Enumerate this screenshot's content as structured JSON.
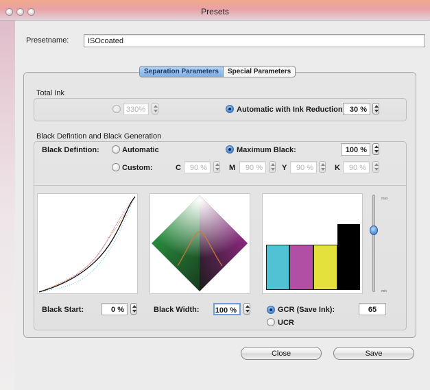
{
  "window": {
    "title": "Presets"
  },
  "preset": {
    "label": "Presetname:",
    "value": "ISOcoated"
  },
  "tabs": [
    {
      "label": "Separation Parameters",
      "active": true
    },
    {
      "label": "Special Parameters",
      "active": false
    }
  ],
  "total_ink": {
    "title": "Total Ink",
    "manual_value": "330%",
    "auto_label": "Automatic with Ink Reduction:",
    "auto_value": "30 %"
  },
  "black": {
    "section_title": "Black Defintion and Black Generation",
    "def_label": "Black Defintion:",
    "automatic_label": "Automatic",
    "maximum_label": "Maximum Black:",
    "maximum_value": "100 %",
    "custom_label": "Custom:",
    "c_label": "C",
    "c_value": "90 %",
    "m_label": "M",
    "m_value": "90 %",
    "y_label": "Y",
    "y_value": "90 %",
    "k_label": "K",
    "k_value": "90 %"
  },
  "generation": {
    "start_label": "Black Start:",
    "start_value": "0 %",
    "width_label": "Black Width:",
    "width_value": "100 %",
    "gcr_label": "GCR (Save Ink):",
    "gcr_value": "65",
    "ucr_label": "UCR",
    "slider_max": "max",
    "slider_min": "min",
    "slider_level": 0.65
  },
  "buttons": {
    "close": "Close",
    "save": "Save"
  },
  "colors": {
    "cyan": "#4fc3d4",
    "magenta": "#b04fa3",
    "yellow": "#e4e03c",
    "black": "#000000"
  },
  "icons": {
    "radio": "radio-button-icon",
    "stepper": "stepper-icon"
  }
}
